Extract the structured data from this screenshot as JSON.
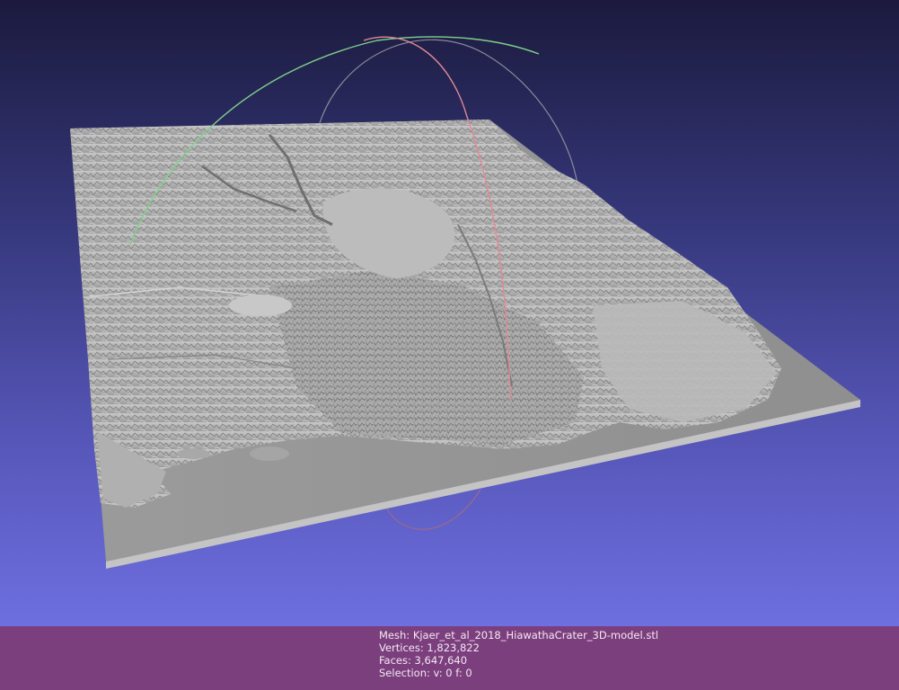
{
  "viewport": {
    "background_top": "#1b1a3d",
    "background_bottom": "#6e6fe0",
    "trackball_colors": {
      "green_ring": "#7fd08a",
      "red_ring": "#e08a96",
      "gray_ring": "#8a8a9a"
    }
  },
  "status": {
    "background": "#7c3f7e",
    "mesh_label": "Mesh:",
    "mesh_value": "Kjaer_et_al_2018_HiawathaCrater_3D-model.stl",
    "vertices_label": "Vertices:",
    "vertices_value": "1,823,822",
    "faces_label": "Faces:",
    "faces_value": "3,647,640",
    "selection_label": "Selection:",
    "selection_value": "v: 0 f: 0"
  }
}
